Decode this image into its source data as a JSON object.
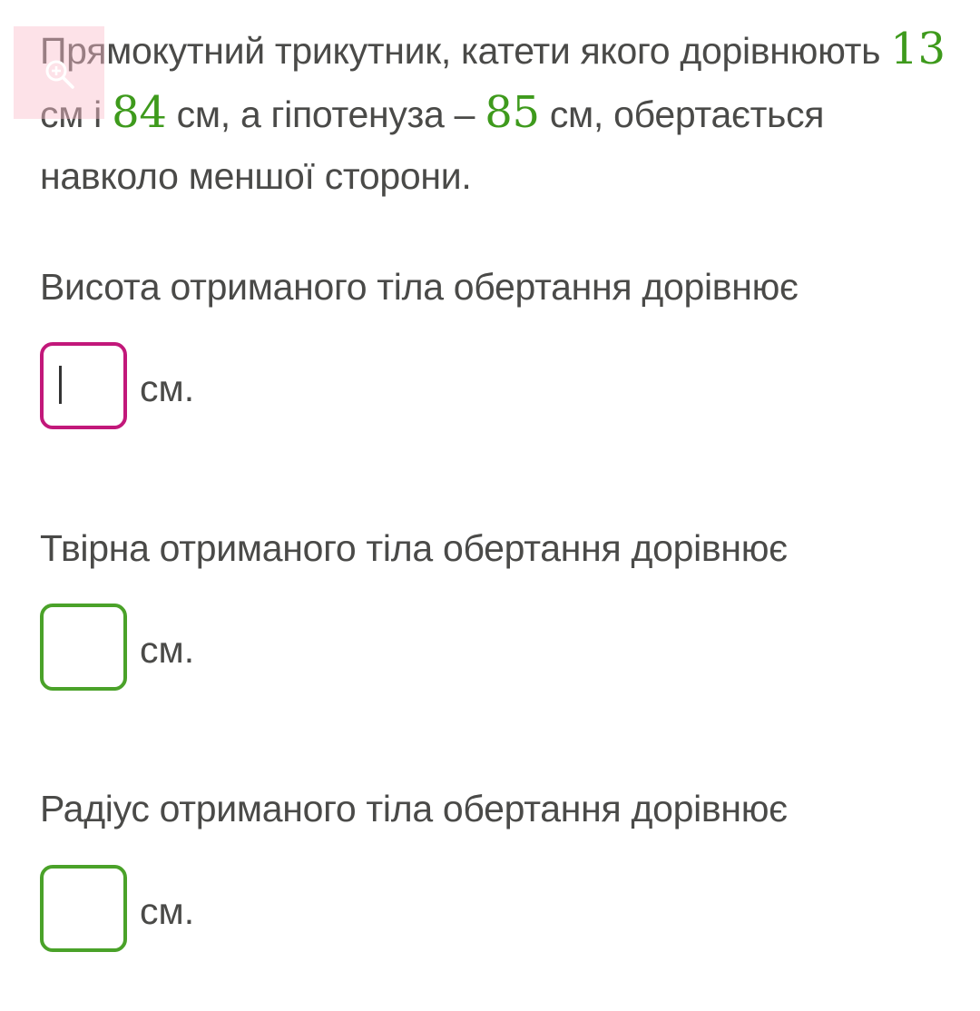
{
  "problem": {
    "part1": "Прямокутний трикутник, катети якого дорівнюють ",
    "leg_a": "13",
    "part2": " см і ",
    "leg_b": "84",
    "part3": " см, а гіпотенуза – ",
    "hypotenuse": "85",
    "part4": " см, обертається навколо меншої сторони."
  },
  "zoom_icon": "zoom-in-icon",
  "colors": {
    "number": "#3e9a1c",
    "active_border": "#c2187a",
    "idle_border": "#4aa229",
    "text": "#4a4a48"
  },
  "questions": [
    {
      "label": "Висота отриманого тіла обертання дорівнює",
      "value": "",
      "unit": "см."
    },
    {
      "label": "Твірна отриманого тіла обертання дорівнює",
      "value": "",
      "unit": "см."
    },
    {
      "label": "Радіус отриманого тіла обертання дорівнює",
      "value": "",
      "unit": "см."
    }
  ]
}
